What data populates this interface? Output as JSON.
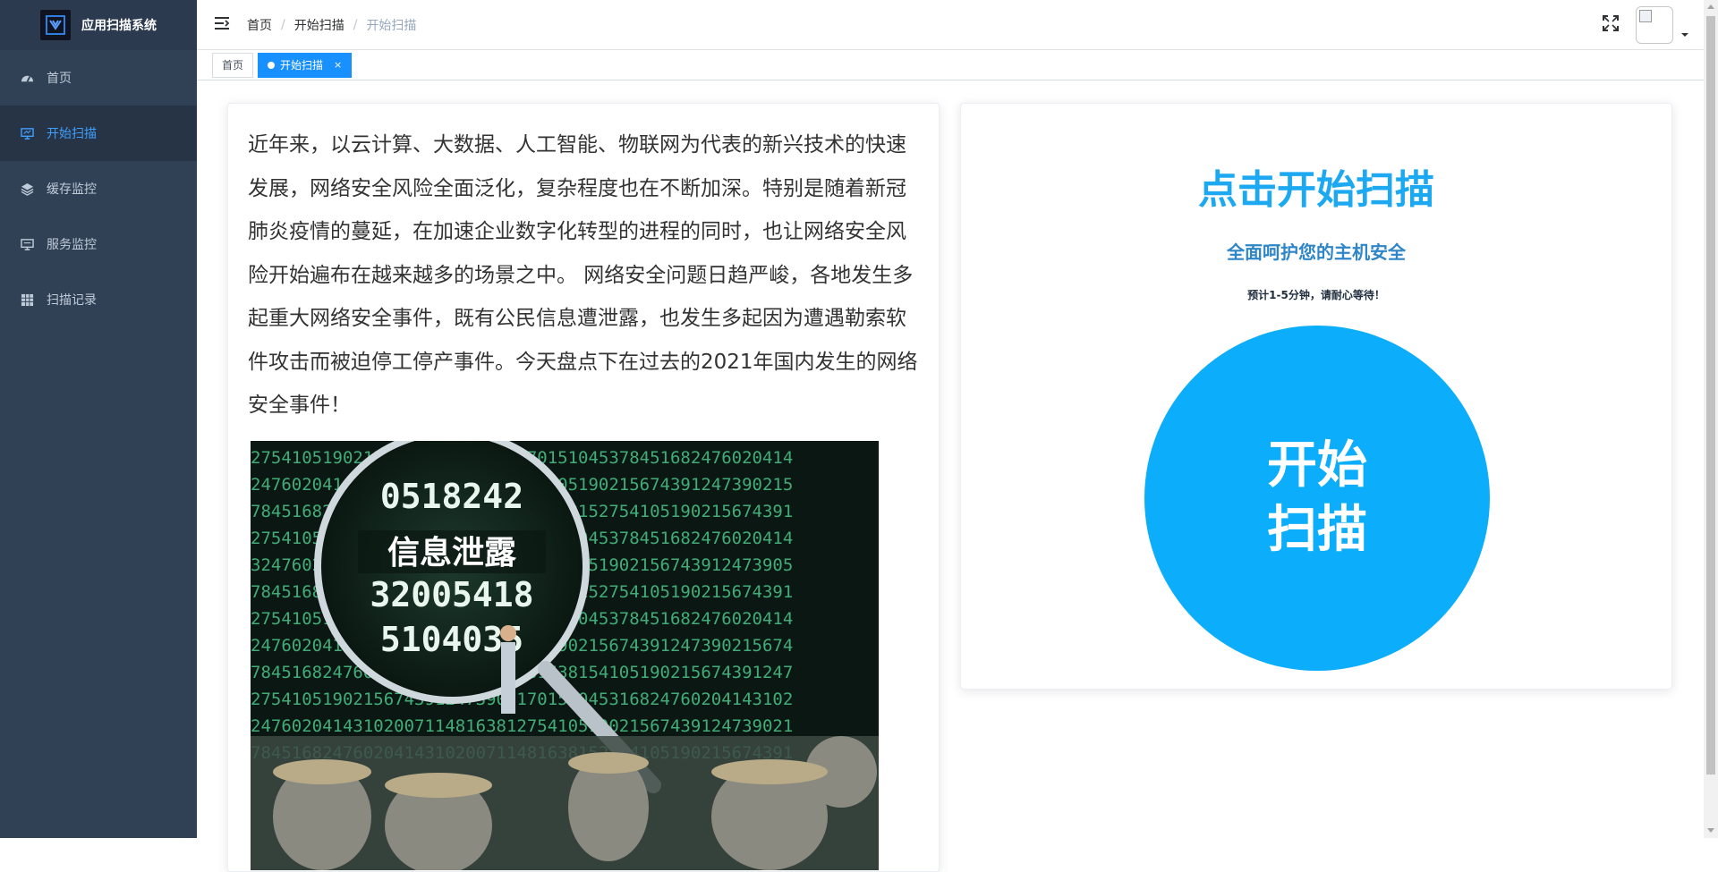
{
  "sidebar": {
    "title": "应用扫描系统",
    "items": [
      {
        "label": "首页",
        "icon": "dashboard-icon"
      },
      {
        "label": "开始扫描",
        "icon": "monitor-icon"
      },
      {
        "label": "缓存监控",
        "icon": "layers-icon"
      },
      {
        "label": "服务监控",
        "icon": "screen-icon"
      },
      {
        "label": "扫描记录",
        "icon": "table-icon"
      }
    ],
    "active_index": 1
  },
  "navbar": {
    "breadcrumb": [
      "首页",
      "开始扫描",
      "开始扫描"
    ],
    "separator": "/"
  },
  "tags": {
    "home": "首页",
    "active": "开始扫描",
    "close": "×"
  },
  "article": {
    "text": "近年来，以云计算、大数据、人工智能、物联网为代表的新兴技术的快速发展，网络安全风险全面泛化，复杂程度也在不断加深。特别是随着新冠肺炎疫情的蔓延，在加速企业数字化转型的进程的同时，也让网络安全风险开始遍布在越来越多的场景之中。 网络安全问题日趋严峻，各地发生多起重大网络安全事件，既有公民信息遭泄露，也发生多起因为遭遇勒索软件攻击而被迫停工停产事件。今天盘点下在过去的2021年国内发生的网络安全事件！",
    "image": {
      "caption": "信息泄露",
      "digits": [
        "0518242",
        "32005418",
        "5104035"
      ]
    }
  },
  "scan": {
    "title": "点击开始扫描",
    "subtitle": "全面呵护您的主机安全",
    "hint": "预计1-5分钟，请耐心等待！",
    "button_line1": "开始",
    "button_line2": "扫描"
  },
  "colors": {
    "sidebar_bg": "#304156",
    "active_menu_text": "#409eff",
    "active_tag_bg": "#1890ff",
    "scan_title": "#1da9f1",
    "scan_button": "#0cadfa"
  }
}
